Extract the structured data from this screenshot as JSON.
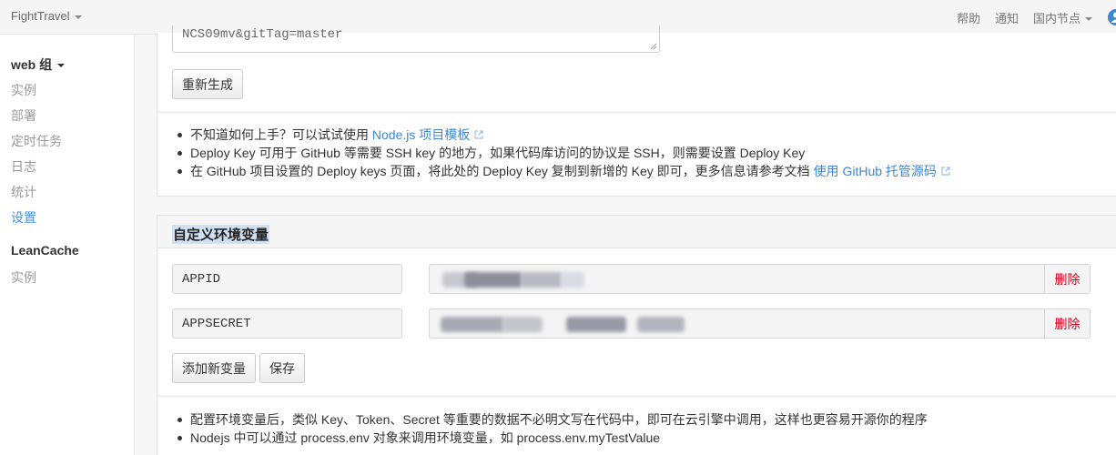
{
  "navbar": {
    "brand": "FightTravel",
    "links": [
      "帮助",
      "通知",
      "国内节点"
    ],
    "icons": {
      "dropdown": "caret-down-icon",
      "user": "user-icon"
    }
  },
  "sidebar": {
    "groups": [
      {
        "title": "web 组",
        "items": [
          "实例",
          "部署",
          "定时任务",
          "日志",
          "统计",
          "设置"
        ],
        "active": "设置"
      },
      {
        "title": "LeanCache",
        "items": [
          "实例"
        ]
      }
    ]
  },
  "deploy": {
    "textarea_value": "NCS09mv&gitTag=master",
    "regenerate_label": "重新生成",
    "tips": {
      "t1_text": "不知道如何上手？可以试试使用 ",
      "t1_link": "Node.js 项目模板",
      "t2_text": "Deploy Key 可用于 GitHub 等需要 SSH key 的地方，如果代码库访问的协议是 SSH，则需要设置 Deploy Key",
      "t3_text": "在 GitHub 项目设置的 Deploy keys 页面，将此处的 Deploy Key 复制到新增的 Key 即可，更多信息请参考文档 ",
      "t3_link": "使用 GitHub 托管源码"
    }
  },
  "env": {
    "title": "自定义环境变量",
    "vars": [
      {
        "name": "APPID",
        "delete_label": "删除"
      },
      {
        "name": "APPSECRET",
        "delete_label": "删除"
      }
    ],
    "add_label": "添加新变量",
    "save_label": "保存",
    "tips": [
      "配置环境变量后，类似 Key、Token、Secret 等重要的数据不必明文写在代码中，即可在云引擎中调用，这样也更容易开源你的程序",
      "Nodejs 中可以通过 process.env 对象来调用环境变量，如 process.env.myTestValue"
    ]
  },
  "colors": {
    "accent": "#4a90e2",
    "link": "#3e87d6",
    "danger": "#d0021b"
  }
}
